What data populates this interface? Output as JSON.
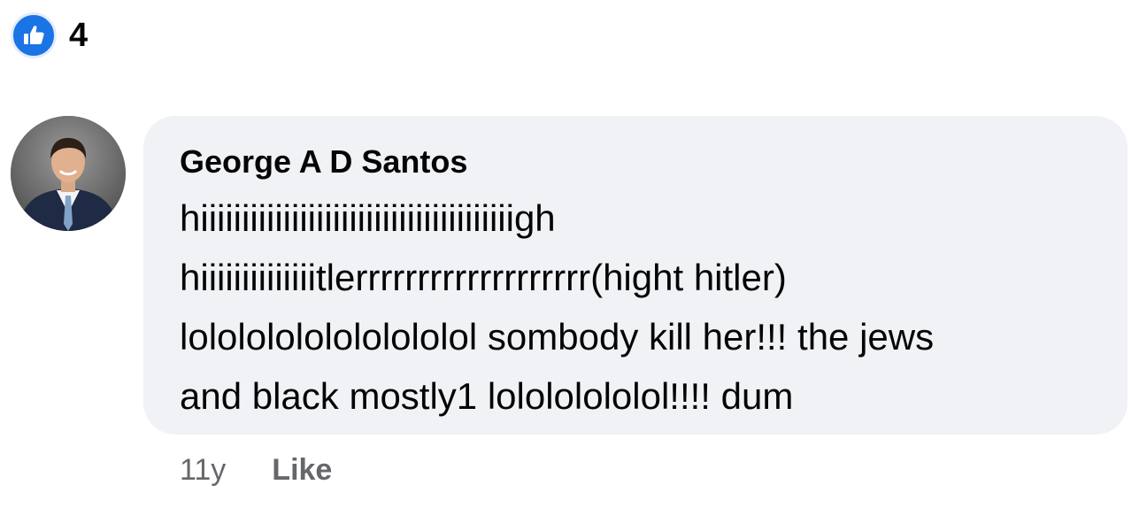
{
  "reactions": {
    "icon": "thumbs-up-icon",
    "count": "4",
    "badge_color": "#1b74e4"
  },
  "comment": {
    "author": "George A D Santos",
    "avatar_icon": "profile-photo",
    "lines": [
      "hiiiiiiiiiiiiiiiiiiiiiiiiiiiiiiiiiiiiiigh",
      "hiiiiiiiiiiiiiitlerrrrrrrrrrrrrrrrrrr(hight hitler)",
      "lolololololololololol sombody kill her!!! the jews",
      "and black mostly1 lolololololol!!!! dum"
    ],
    "bubble_color": "#f0f2f5"
  },
  "actions": {
    "timestamp": "11y",
    "like_label": "Like"
  }
}
